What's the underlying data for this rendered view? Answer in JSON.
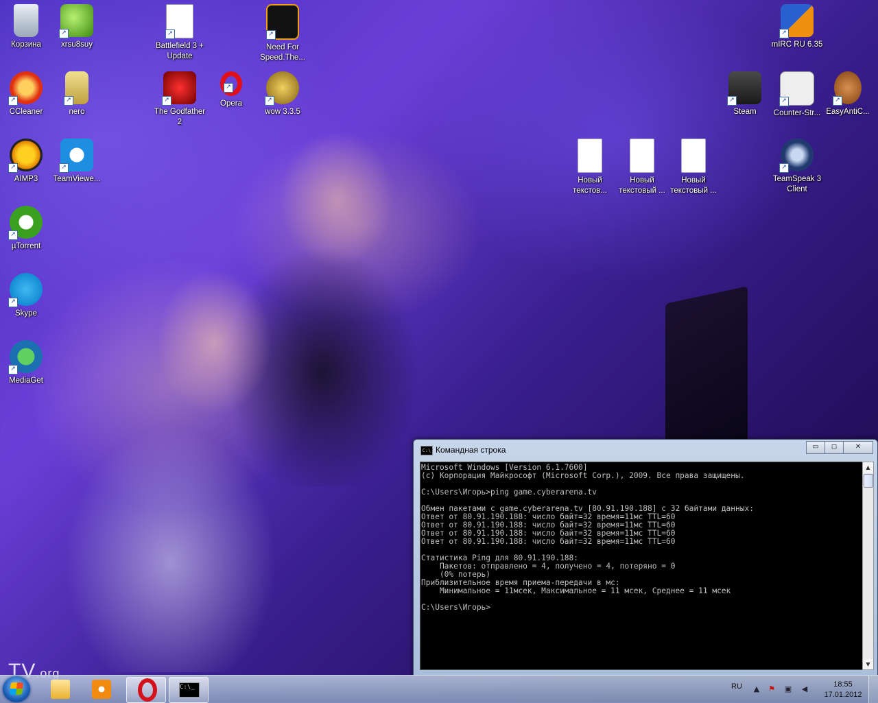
{
  "desktop": {
    "icons": [
      {
        "label": "Корзина",
        "glyph": "recycle-bin-icon"
      },
      {
        "label": "xrsu8suy",
        "glyph": "shield-icon"
      },
      {
        "label": "Battlefield 3 + Update",
        "glyph": "document-icon"
      },
      {
        "label": "Need For Speed.The...",
        "glyph": "nfs-icon"
      },
      {
        "label": "mIRC RU 6.35",
        "glyph": "mirc-icon"
      },
      {
        "label": "CCleaner",
        "glyph": "ccleaner-icon"
      },
      {
        "label": "nero",
        "glyph": "nero-icon"
      },
      {
        "label": "The Godfather 2",
        "glyph": "godfather-icon"
      },
      {
        "label": "Opera",
        "glyph": "opera-icon"
      },
      {
        "label": "wow 3.3.5",
        "glyph": "wow-icon"
      },
      {
        "label": "Steam",
        "glyph": "steam-icon"
      },
      {
        "label": "Counter-Str...",
        "glyph": "counter-strike-icon"
      },
      {
        "label": "EasyAntiC...",
        "glyph": "teddy-bear-icon"
      },
      {
        "label": "AIMP3",
        "glyph": "aimp-icon"
      },
      {
        "label": "TeamViewe...",
        "glyph": "teamviewer-icon"
      },
      {
        "label": "Новый текстов...",
        "glyph": "text-file-icon"
      },
      {
        "label": "Новый текстовый ...",
        "glyph": "text-file-icon"
      },
      {
        "label": "Новый текстовый ...",
        "glyph": "text-file-icon"
      },
      {
        "label": "TeamSpeak 3 Client",
        "glyph": "teamspeak-icon"
      },
      {
        "label": "µTorrent",
        "glyph": "utorrent-icon"
      },
      {
        "label": "Skype",
        "glyph": "skype-icon"
      },
      {
        "label": "MediaGet",
        "glyph": "mediaget-icon"
      }
    ],
    "watermark": "TV",
    "watermark_suffix": ".org"
  },
  "cmd": {
    "title": "Командная строка",
    "minimize": "▭",
    "maximize": "◻",
    "close": "✕",
    "output": "Microsoft Windows [Version 6.1.7600]\n(c) Корпорация Майкрософт (Microsoft Corp.), 2009. Все права защищены.\n\nC:\\Users\\Игорь>ping game.cyberarena.tv\n\nОбмен пакетами с game.cyberarena.tv [80.91.190.188] с 32 байтами данных:\nОтвет от 80.91.190.188: число байт=32 время=11мс TTL=60\nОтвет от 80.91.190.188: число байт=32 время=11мс TTL=60\nОтвет от 80.91.190.188: число байт=32 время=11мс TTL=60\nОтвет от 80.91.190.188: число байт=32 время=11мс TTL=60\n\nСтатистика Ping для 80.91.190.188:\n    Пакетов: отправлено = 4, получено = 4, потеряно = 0\n    (0% потерь)\nПриблизительное время приема-передачи в мс:\n    Минимальное = 11мсек, Максимальное = 11 мсек, Среднее = 11 мсек\n\nC:\\Users\\Игорь>"
  },
  "taskbar": {
    "language": "RU",
    "time": "18:55",
    "date": "17.01.2012",
    "colors": {
      "opera_red": "#d4101a",
      "cmd_black": "#000000"
    }
  }
}
